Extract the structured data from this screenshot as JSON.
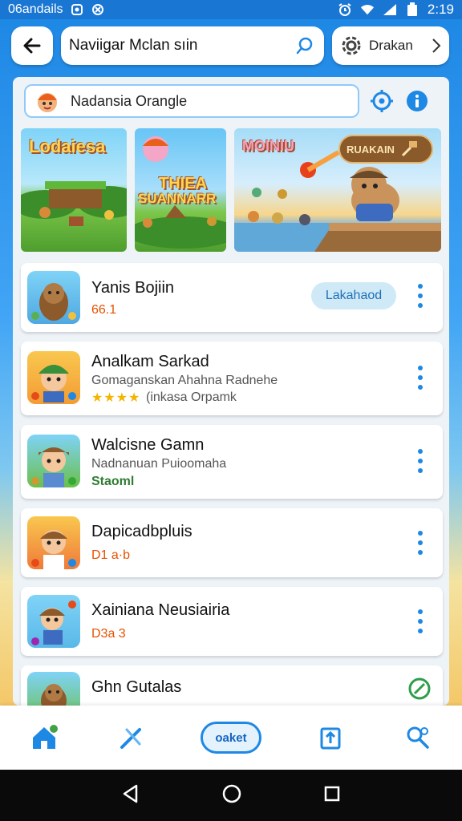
{
  "status_bar": {
    "left_text": "06andails",
    "time": "2:19",
    "icons": [
      "shield-icon",
      "swirl-icon",
      "alarm-icon",
      "wifi-icon",
      "signal-icon",
      "battery-icon"
    ]
  },
  "top_bar": {
    "search_text": "Naviigar Mclan sıin",
    "account_label": "Drakan",
    "icons": [
      "back-arrow-icon",
      "search-icon",
      "settings-icon",
      "chevron-right-icon"
    ]
  },
  "filter": {
    "text": "Nadansia Orangle",
    "icons": [
      "avatar-icon",
      "location-icon",
      "info-icon"
    ]
  },
  "banners": [
    {
      "title": "Lodaiesa"
    },
    {
      "title_line1": "THIEA",
      "title_line2": "SUANNARR"
    },
    {
      "title": "MOINIU",
      "badge": "RUAKAIN"
    }
  ],
  "apps": [
    {
      "name": "Yanis Bojiin",
      "meta": "66.1",
      "meta_color": "#e65100",
      "action": "Lakahaod"
    },
    {
      "name": "Analkam Sarkad",
      "subtitle": "Gomaganskan Ahahna Radnehe",
      "rating_stars": 4,
      "rating_text": "(inkasa Orpamk",
      "meta_color": "#555555"
    },
    {
      "name": "Walcisne Gamn",
      "subtitle": "Nadnanuan Puioomaha",
      "meta": "Staoml",
      "meta_color": "#2e7d32"
    },
    {
      "name": "Dapicadbpluis",
      "meta": "D1 a·b",
      "meta_color": "#e65100"
    },
    {
      "name": "Xainiana Neusiairia",
      "meta": "D3a 3",
      "meta_color": "#e65100"
    },
    {
      "name": "Ghn Gutalas",
      "meta": "",
      "meta_color": "#555555"
    }
  ],
  "bottom_nav": {
    "center_label": "oaket",
    "icons": [
      "home-icon",
      "tools-icon",
      "share-card-icon",
      "search-people-icon"
    ]
  },
  "colors": {
    "primary": "#1e88e5",
    "accent_orange": "#e65100",
    "accent_green": "#2e7d32"
  }
}
